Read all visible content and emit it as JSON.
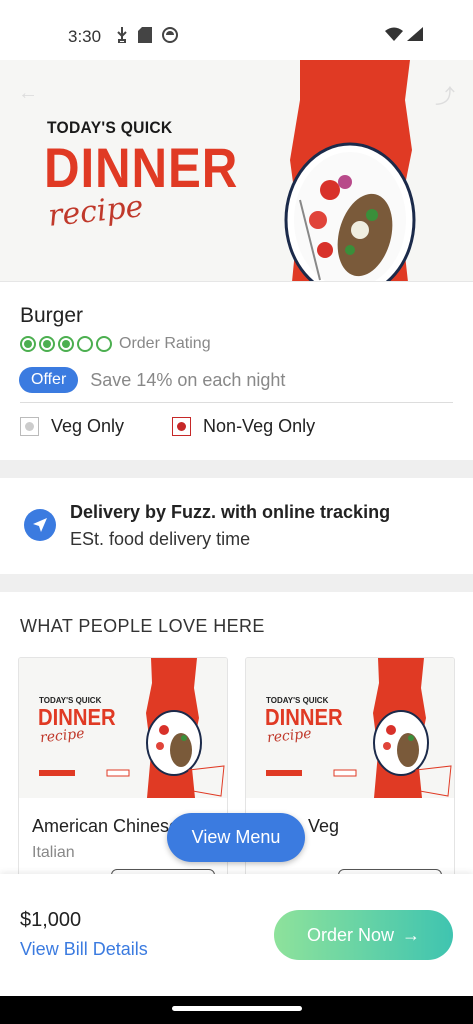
{
  "status_bar": {
    "time": "3:30",
    "icons_left": [
      "usb-icon",
      "sd-card-icon",
      "circle-app-icon"
    ],
    "icons_right": [
      "wifi-icon",
      "signal-icon"
    ]
  },
  "hero": {
    "line1": "TODAY'S QUICK",
    "line2": "DINNER",
    "line3": "recipe",
    "accent_color": "#e03a24"
  },
  "dish": {
    "name": "Burger",
    "rating": 3,
    "rating_max": 5,
    "rating_label": "Order Rating"
  },
  "offer": {
    "badge": "Offer",
    "text": "Save 14% on each night"
  },
  "filters": {
    "veg_label": "Veg Only",
    "nonveg_label": "Non-Veg Only"
  },
  "delivery": {
    "title": "Delivery by Fuzz. with online tracking",
    "subtitle": "ESt. food delivery time"
  },
  "recommendations": {
    "title": "WHAT PEOPLE LOVE HERE",
    "cards": [
      {
        "name": "American Chinese",
        "cuisine": "Italian",
        "img_line1": "TODAY'S QUICK",
        "img_line2": "DINNER",
        "img_line3": "recipe"
      },
      {
        "name": "Veg",
        "cuisine": "",
        "img_line1": "TODAY'S QUICK",
        "img_line2": "DINNER",
        "img_line3": "recipe"
      }
    ]
  },
  "fab": {
    "label": "View Menu"
  },
  "bottom": {
    "total": "$1,000",
    "bill_link": "View Bill Details",
    "order_button": "Order Now",
    "order_arrow": "→"
  },
  "colors": {
    "primary": "#3b7be0",
    "rating_green": "#4caf50",
    "nonveg_red": "#c62828",
    "order_gradient_start": "#8ee29b",
    "order_gradient_end": "#3fc4b0"
  }
}
